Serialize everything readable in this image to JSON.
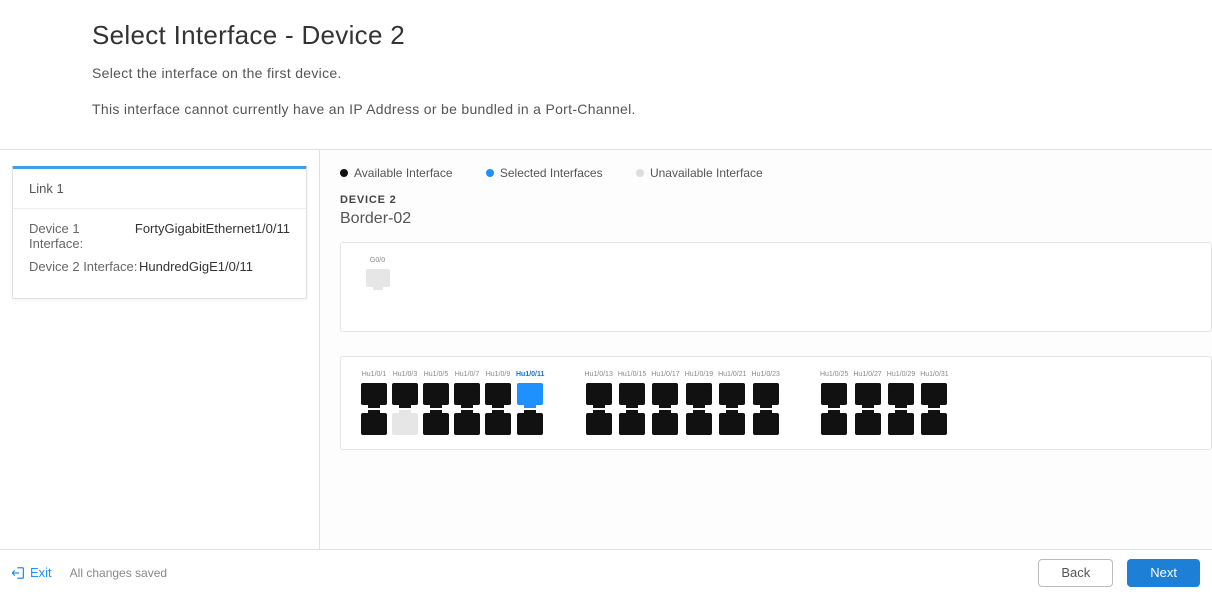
{
  "header": {
    "title": "Select Interface - Device 2",
    "subtitle": "Select the interface on the first device.",
    "note": "This interface cannot currently have an IP Address or be bundled in a Port-Channel."
  },
  "sidebar": {
    "link_card": {
      "title": "Link 1",
      "device1_label": "Device 1 Interface:",
      "device1_value": "FortyGigabitEthernet1/0/11",
      "device2_label": "Device 2 Interface:",
      "device2_value": "HundredGigE1/0/11"
    }
  },
  "legend": {
    "available": "Available Interface",
    "selected": "Selected Interfaces",
    "unavailable": "Unavailable Interface"
  },
  "device": {
    "label": "DEVICE 2",
    "name": "Border-02"
  },
  "chassis1": {
    "ports": [
      {
        "label": "G0/0",
        "status": "unavailable"
      }
    ]
  },
  "chassis2": {
    "groups": [
      {
        "columns": [
          {
            "top_label": "Hu1/0/1",
            "top_status": "available",
            "bottom_status": "available"
          },
          {
            "top_label": "Hu1/0/3",
            "top_status": "available",
            "bottom_status": "unavailable"
          },
          {
            "top_label": "Hu1/0/5",
            "top_status": "available",
            "bottom_status": "available"
          },
          {
            "top_label": "Hu1/0/7",
            "top_status": "available",
            "bottom_status": "available"
          },
          {
            "top_label": "Hu1/0/9",
            "top_status": "available",
            "bottom_status": "available"
          },
          {
            "top_label": "Hu1/0/11",
            "top_status": "selected",
            "bottom_status": "available"
          }
        ]
      },
      {
        "columns": [
          {
            "top_label": "Hu1/0/13",
            "top_status": "available",
            "bottom_status": "available"
          },
          {
            "top_label": "Hu1/0/15",
            "top_status": "available",
            "bottom_status": "available"
          },
          {
            "top_label": "Hu1/0/17",
            "top_status": "available",
            "bottom_status": "available"
          },
          {
            "top_label": "Hu1/0/19",
            "top_status": "available",
            "bottom_status": "available"
          },
          {
            "top_label": "Hu1/0/21",
            "top_status": "available",
            "bottom_status": "available"
          },
          {
            "top_label": "Hu1/0/23",
            "top_status": "available",
            "bottom_status": "available"
          }
        ]
      },
      {
        "columns": [
          {
            "top_label": "Hu1/0/25",
            "top_status": "available",
            "bottom_status": "available"
          },
          {
            "top_label": "Hu1/0/27",
            "top_status": "available",
            "bottom_status": "available"
          },
          {
            "top_label": "Hu1/0/29",
            "top_status": "available",
            "bottom_status": "available"
          },
          {
            "top_label": "Hu1/0/31",
            "top_status": "available",
            "bottom_status": "available"
          }
        ]
      }
    ]
  },
  "footer": {
    "exit": "Exit",
    "saved": "All changes saved",
    "back": "Back",
    "next": "Next"
  }
}
